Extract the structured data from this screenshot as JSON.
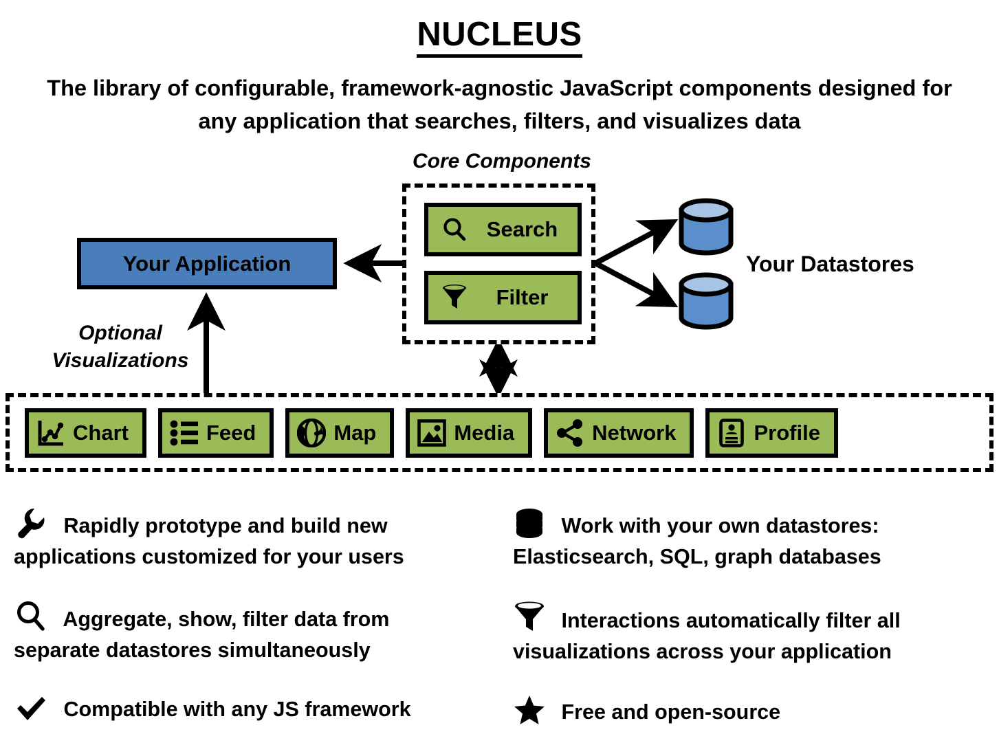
{
  "header": {
    "title": "NUCLEUS",
    "subtitle": "The library of configurable, framework-agnostic JavaScript components designed for any application that searches, filters, and visualizes data"
  },
  "diagram": {
    "core_label": "Core Components",
    "core_components": [
      {
        "label": "Search",
        "icon": "magnifier-icon"
      },
      {
        "label": "Filter",
        "icon": "funnel-icon"
      }
    ],
    "application_label": "Your Application",
    "datastores_label": "Your Datastores",
    "datastore_count": 2,
    "optional_label_line1": "Optional",
    "optional_label_line2": "Visualizations",
    "visualizations": [
      {
        "label": "Chart",
        "icon": "line-chart-icon"
      },
      {
        "label": "Feed",
        "icon": "list-icon"
      },
      {
        "label": "Map",
        "icon": "globe-icon"
      },
      {
        "label": "Media",
        "icon": "image-icon"
      },
      {
        "label": "Network",
        "icon": "share-network-icon"
      },
      {
        "label": "Profile",
        "icon": "id-card-icon"
      }
    ]
  },
  "features": [
    {
      "icon": "wrench-icon",
      "line1": "Rapidly prototype and build new",
      "line2": "applications customized for your users"
    },
    {
      "icon": "database-stack-icon",
      "line1": "Work with your own datastores:",
      "line2": "Elasticsearch, SQL, graph databases"
    },
    {
      "icon": "magnifier-icon",
      "line1": "Aggregate, show, filter data from",
      "line2": "separate datastores simultaneously"
    },
    {
      "icon": "funnel-icon",
      "line1": "Interactions automatically filter all",
      "line2": "visualizations across your application"
    },
    {
      "icon": "checkmark-icon",
      "line1": "Compatible with any JS framework",
      "line2": ""
    },
    {
      "icon": "star-icon",
      "line1": "Free and open-source",
      "line2": ""
    }
  ],
  "colors": {
    "component_green": "#9BBB59",
    "application_blue": "#4A7EBB",
    "datastore_blue": "#5B8FCB",
    "outline_black": "#000000",
    "background": "#FFFFFF"
  }
}
